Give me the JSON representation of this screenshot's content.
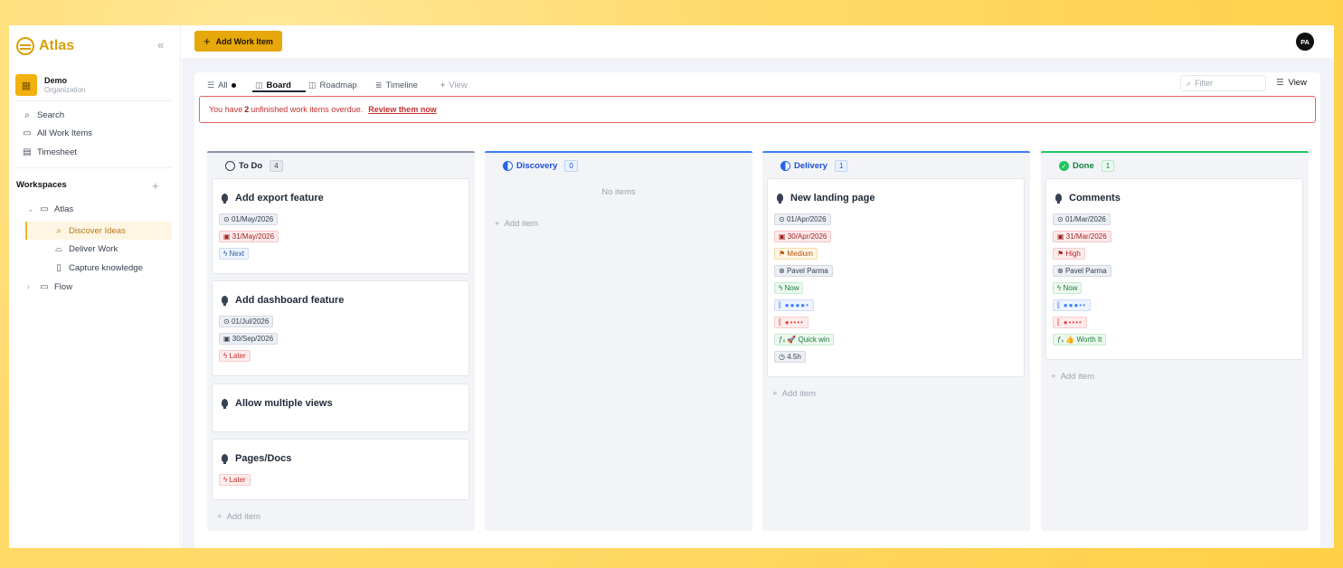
{
  "app": {
    "name": "Atlas",
    "collapse_icon": "«"
  },
  "org": {
    "name": "Demo",
    "subtitle": "Organization"
  },
  "nav": [
    {
      "label": "Search",
      "icon": "search-icon"
    },
    {
      "label": "All Work Items",
      "icon": "inbox-icon"
    },
    {
      "label": "Timesheet",
      "icon": "table-icon"
    }
  ],
  "workspaces": {
    "title": "Workspaces",
    "add": "+",
    "atlas": "Atlas",
    "discover": "Discover Ideas",
    "deliver": "Deliver Work",
    "capture": "Capture knowledge",
    "flow": "Flow"
  },
  "topbar": {
    "add_button": "Add Work Item",
    "avatar": "PA"
  },
  "tabs": {
    "all": "All",
    "board": "Board",
    "roadmap": "Roadmap",
    "timeline": "Timeline",
    "add_view": "View"
  },
  "toolbar": {
    "filter_placeholder": "Filter",
    "view": "View"
  },
  "alert": {
    "prefix": "You have",
    "count": "2",
    "suffix": "unfinished work items overdue.",
    "link": "Review them now"
  },
  "columns": {
    "todo": {
      "title": "To Do",
      "count": "4"
    },
    "discovery": {
      "title": "Discovery",
      "count": "0",
      "empty": "No items"
    },
    "delivery": {
      "title": "Delivery",
      "count": "1"
    },
    "done": {
      "title": "Done",
      "count": "1"
    },
    "add_item": "Add item"
  },
  "cards": {
    "export": {
      "title": "Add export feature",
      "start": "01/May/2026",
      "end": "31/May/2026",
      "horizon": "Next"
    },
    "dashboard": {
      "title": "Add dashboard feature",
      "start": "01/Jul/2026",
      "end": "30/Sep/2026",
      "horizon": "Later"
    },
    "views": {
      "title": "Allow multiple views"
    },
    "pages": {
      "title": "Pages/Docs",
      "horizon": "Later"
    },
    "landing": {
      "title": "New landing page",
      "start": "01/Apr/2026",
      "end": "30/Apr/2026",
      "priority": "Medium",
      "assignee": "Pavel Parma",
      "horizon": "Now",
      "impact": "●●●●•",
      "effort": "●••••",
      "score": "🚀 Quick win",
      "estimate": "4.5h"
    },
    "comments": {
      "title": "Comments",
      "start": "01/Mar/2026",
      "end": "31/Mar/2026",
      "priority": "High",
      "assignee": "Pavel Parma",
      "horizon": "Now",
      "impact": "●●●••",
      "effort": "●••••",
      "score": "👍 Worth It"
    }
  },
  "colors": {
    "accent": "#e6a80a",
    "todo": "#8a94a6",
    "discovery": "#3b82f6",
    "delivery": "#3b82f6",
    "done": "#22c55e"
  }
}
